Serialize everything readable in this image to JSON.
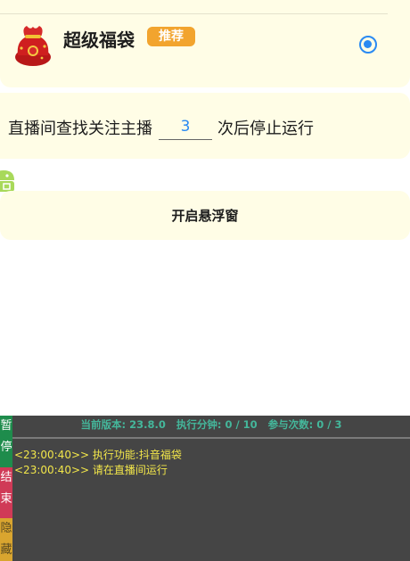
{
  "option": {
    "title": "超级福袋",
    "badge": "推荐",
    "selected": true,
    "accent_color": "#2a8af2",
    "badge_color": "#f2a42e"
  },
  "stop_setting": {
    "prefix": "直播间查找关注主播",
    "value": "3",
    "suffix": "次后停止运行"
  },
  "float_button": {
    "label": "开启悬浮窗"
  },
  "console": {
    "version_label": "当前版本: 23.8.0",
    "minutes_label": "执行分钟: 0 / 10",
    "count_label": "参与次数: 0 / 3",
    "logs": [
      "<23:00:40>> 执行功能:抖音福袋",
      "<23:00:40>> 请在直播间运行"
    ],
    "side_buttons": {
      "pause": "暂停",
      "end": "结束",
      "hide": "隐藏"
    }
  },
  "icons": {
    "bag": "lucky-bag-icon",
    "android": "android-icon"
  }
}
